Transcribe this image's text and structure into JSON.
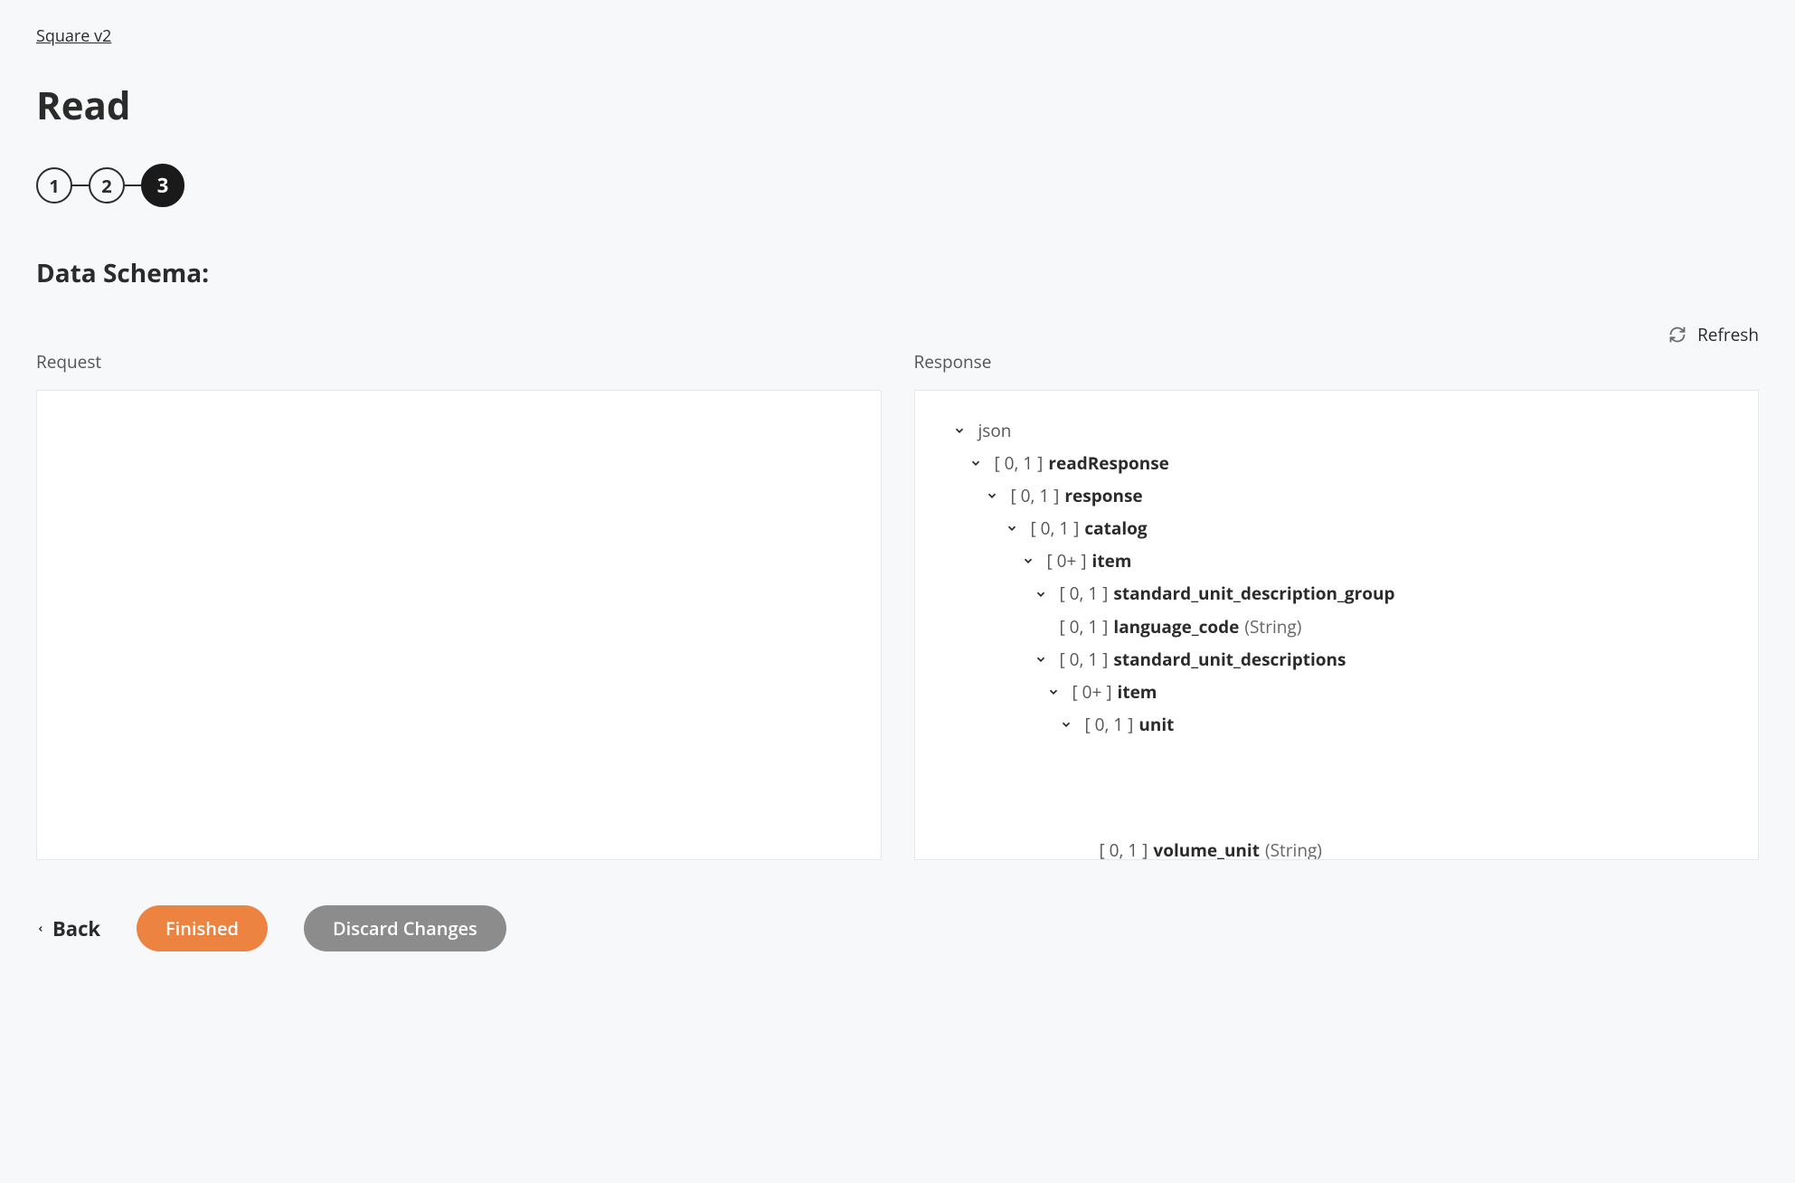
{
  "breadcrumb": "Square v2",
  "title": "Read",
  "steps": [
    "1",
    "2",
    "3"
  ],
  "activeStep": 3,
  "sectionTitle": "Data Schema:",
  "refreshLabel": "Refresh",
  "panels": {
    "request": {
      "label": "Request"
    },
    "response": {
      "label": "Response"
    }
  },
  "tree": {
    "root": "json",
    "nodes": [
      {
        "indent": 0,
        "chevron": true,
        "range": "",
        "name": "json",
        "type": "",
        "rootStyle": true
      },
      {
        "indent": 1,
        "chevron": true,
        "range": "[ 0, 1 ]",
        "name": "readResponse",
        "type": ""
      },
      {
        "indent": 2,
        "chevron": true,
        "range": "[ 0, 1 ]",
        "name": "response",
        "type": ""
      },
      {
        "indent": 3,
        "chevron": true,
        "range": "[ 0, 1 ]",
        "name": "catalog",
        "type": ""
      },
      {
        "indent": 4,
        "chevron": true,
        "range": "[ 0+ ]",
        "name": "item",
        "type": ""
      },
      {
        "indent": 5,
        "chevron": true,
        "range": "[ 0, 1 ]",
        "name": "standard_unit_description_group",
        "type": ""
      },
      {
        "indent": 6,
        "chevron": false,
        "range": "[ 0, 1 ]",
        "name": "language_code",
        "type": "(String)"
      },
      {
        "indent": 6,
        "chevron": true,
        "range": "[ 0, 1 ]",
        "name": "standard_unit_descriptions",
        "type": ""
      },
      {
        "indent": 7,
        "chevron": true,
        "range": "[ 0+ ]",
        "name": "item",
        "type": ""
      },
      {
        "indent": 8,
        "chevron": true,
        "range": "[ 0, 1 ]",
        "name": "unit",
        "type": ""
      },
      {
        "indent": 9,
        "chevron": false,
        "range": "[ 0, 1 ]",
        "name": "volume_unit",
        "type": "(String)",
        "clipped": true
      }
    ]
  },
  "footer": {
    "back": "Back",
    "finished": "Finished",
    "discard": "Discard Changes"
  }
}
